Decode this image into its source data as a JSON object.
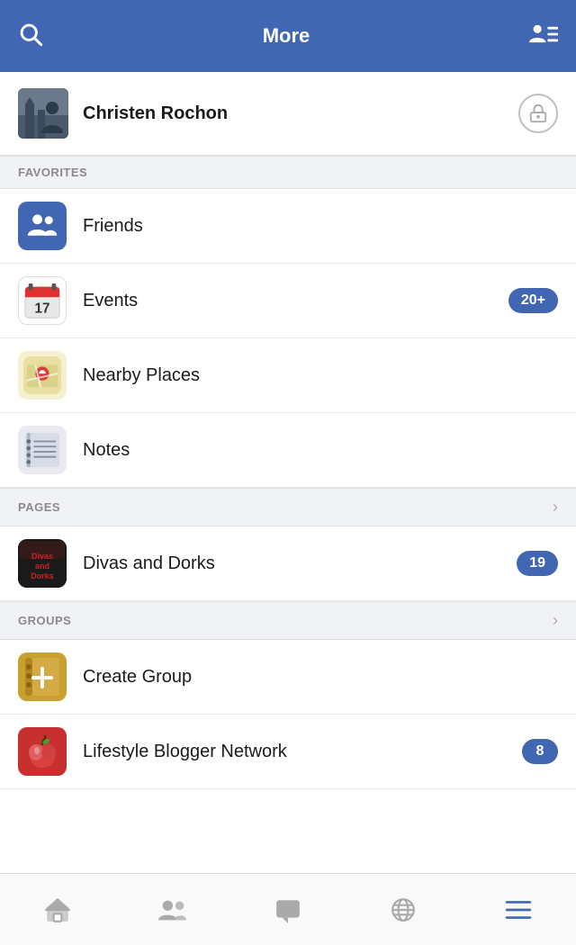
{
  "header": {
    "title": "More",
    "search_icon": "search",
    "profile_icon": "user-list"
  },
  "profile": {
    "name": "Christen Rochon",
    "settings_icon": "lock-settings"
  },
  "sections": [
    {
      "id": "favorites",
      "label": "FAVORITES",
      "has_chevron": false,
      "items": [
        {
          "id": "friends",
          "label": "Friends",
          "icon_type": "friends",
          "badge": null
        },
        {
          "id": "events",
          "label": "Events",
          "icon_type": "events",
          "badge": "20+"
        },
        {
          "id": "nearby-places",
          "label": "Nearby Places",
          "icon_type": "nearby",
          "badge": null
        },
        {
          "id": "notes",
          "label": "Notes",
          "icon_type": "notes",
          "badge": null
        }
      ]
    },
    {
      "id": "pages",
      "label": "PAGES",
      "has_chevron": true,
      "items": [
        {
          "id": "divas-and-dorks",
          "label": "Divas and Dorks",
          "icon_type": "divasdorks",
          "badge": "19"
        }
      ]
    },
    {
      "id": "groups",
      "label": "GROUPS",
      "has_chevron": true,
      "items": [
        {
          "id": "create-group",
          "label": "Create Group",
          "icon_type": "creategroup",
          "badge": null
        },
        {
          "id": "lifestyle-blogger",
          "label": "Lifestyle Blogger Network",
          "icon_type": "lifestyle",
          "badge": "8"
        }
      ]
    }
  ],
  "tab_bar": {
    "items": [
      {
        "id": "home",
        "icon": "home",
        "active": false
      },
      {
        "id": "friends",
        "icon": "friends",
        "active": false
      },
      {
        "id": "messages",
        "icon": "messages",
        "active": false
      },
      {
        "id": "globe",
        "icon": "globe",
        "active": false
      },
      {
        "id": "menu",
        "icon": "menu",
        "active": true
      }
    ]
  }
}
